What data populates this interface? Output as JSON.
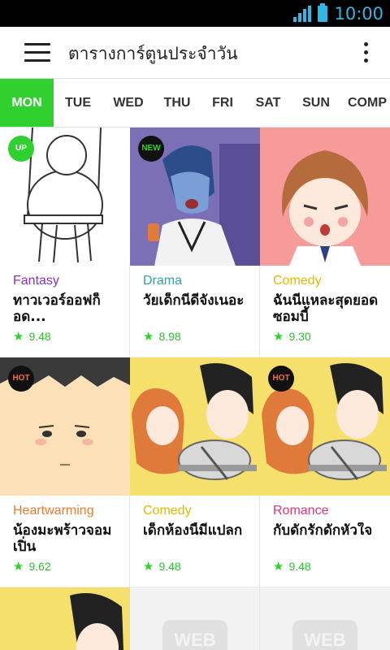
{
  "status_bar": {
    "time": "10:00"
  },
  "app_bar": {
    "title": "ตารางการ์ตูนประจำวัน"
  },
  "tabs": [
    "MON",
    "TUE",
    "WED",
    "THU",
    "FRI",
    "SAT",
    "SUN",
    "COMP"
  ],
  "active_tab": "MON",
  "cards": [
    {
      "badge": "UP",
      "genre": "Fantasy",
      "genre_color": "#8e2fbf",
      "title": "ทาวเวอร์ออฟก็อด...",
      "rating": "9.48"
    },
    {
      "badge": "NEW",
      "genre": "Drama",
      "genre_color": "#2aa7a0",
      "title": "วัยเด็กนี่ดีจังเนอะ",
      "rating": "8.98"
    },
    {
      "badge": "",
      "genre": "Comedy",
      "genre_color": "#e6b800",
      "title": "ฉันนี่แหละสุดยอดซอมบี้",
      "rating": "9.30"
    },
    {
      "badge": "HOT",
      "genre": "Heartwarming",
      "genre_color": "#f07a2a",
      "title": "น้องมะพร้าวจอมเปิ่น",
      "rating": "9.62"
    },
    {
      "badge": "",
      "genre": "Comedy",
      "genre_color": "#e6b800",
      "title": "เด็กห้องนี้มีแปลก",
      "rating": "9.48"
    },
    {
      "badge": "HOT",
      "genre": "Romance",
      "genre_color": "#e0337a",
      "title": "กับดักรักดักหัวใจ",
      "rating": "9.48"
    }
  ],
  "placeholder_logo": "WEB",
  "colors": {
    "accent": "#2fd12f",
    "statusbar_icons": "#33b5e5"
  },
  "icons": {
    "menu": "hamburger-menu-icon",
    "overflow": "overflow-dots-icon",
    "star": "star-icon"
  }
}
